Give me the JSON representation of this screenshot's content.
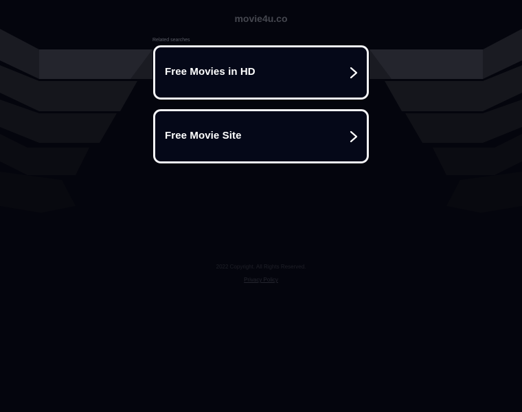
{
  "site": {
    "domain": "movie4u.co"
  },
  "related": {
    "label": "Related searches",
    "items": [
      {
        "label": "Free Movies in HD",
        "icon": "chevron-right-icon"
      },
      {
        "label": "Free Movie Site",
        "icon": "chevron-right-icon"
      }
    ]
  },
  "footer": {
    "copyright": "2022 Copyright. All Rights Reserved.",
    "privacy_label": "Privacy Policy"
  },
  "colors": {
    "background": "#04050d",
    "card_border": "#f4f4f7",
    "card_fill": "#050818"
  }
}
